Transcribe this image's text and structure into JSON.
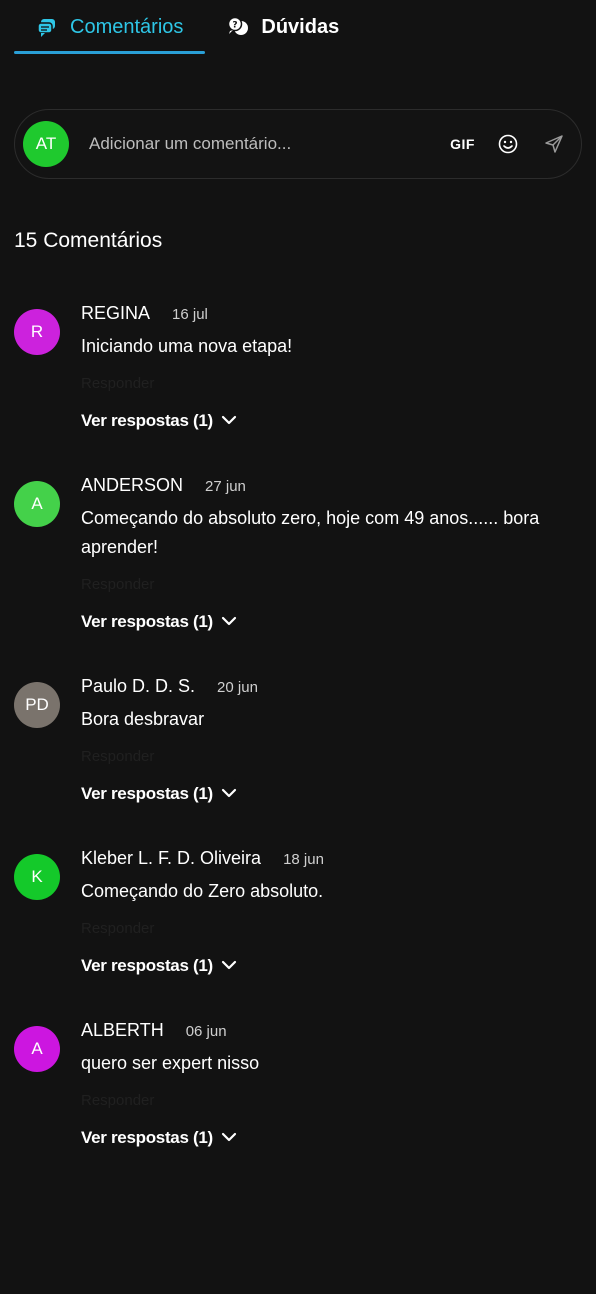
{
  "tabs": [
    {
      "label": "Comentários",
      "icon": "chat-bubbles-icon",
      "active": true
    },
    {
      "label": "Dúvidas",
      "icon": "question-bubbles-icon",
      "active": false
    }
  ],
  "composer": {
    "avatar_initials": "AT",
    "avatar_color": "#1fc92e",
    "placeholder": "Adicionar um comentário...",
    "gif_label": "GIF"
  },
  "comments_count": "15 Comentários",
  "comments": [
    {
      "initials": "R",
      "color": "#cc22dd",
      "author": "REGINA",
      "date": "16 jul",
      "text": "Iniciando uma nova etapa!",
      "reply_label": "Responder",
      "view_replies": "Ver respostas (1)"
    },
    {
      "initials": "A",
      "color": "#44d14a",
      "author": "ANDERSON",
      "date": "27 jun",
      "text": "Começando do absoluto zero, hoje com 49 anos...... bora aprender!",
      "reply_label": "Responder",
      "view_replies": "Ver respostas (1)"
    },
    {
      "initials": "PD",
      "color": "#7a736c",
      "author": "Paulo D. D. S.",
      "date": "20 jun",
      "text": "Bora desbravar",
      "reply_label": "Responder",
      "view_replies": "Ver respostas (1)"
    },
    {
      "initials": "K",
      "color": "#14c92a",
      "author": "Kleber L. F. D. Oliveira",
      "date": "18 jun",
      "text": "Começando do Zero absoluto.",
      "reply_label": "Responder",
      "view_replies": "Ver respostas (1)"
    },
    {
      "initials": "A",
      "color": "#cc16e0",
      "author": "ALBERTH",
      "date": "06 jun",
      "text": "quero ser expert nisso",
      "reply_label": "Responder",
      "view_replies": "Ver respostas (1)"
    }
  ]
}
